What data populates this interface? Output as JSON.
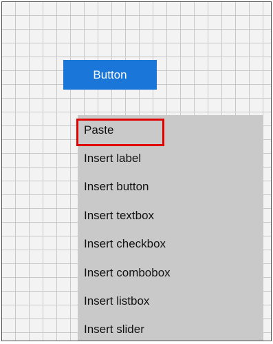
{
  "form": {
    "button_label": "Button"
  },
  "context_menu": {
    "items": [
      {
        "label": "Paste"
      },
      {
        "label": "Insert label"
      },
      {
        "label": "Insert button"
      },
      {
        "label": "Insert textbox"
      },
      {
        "label": "Insert checkbox"
      },
      {
        "label": "Insert combobox"
      },
      {
        "label": "Insert listbox"
      },
      {
        "label": "Insert slider"
      }
    ],
    "highlighted_item": "Paste"
  },
  "colors": {
    "button_bg": "#1a76d8",
    "menu_bg": "#c9c9c9",
    "highlight_border": "#e00000",
    "canvas_bg": "#f3f3f3",
    "grid_line": "#c8c8c8"
  }
}
